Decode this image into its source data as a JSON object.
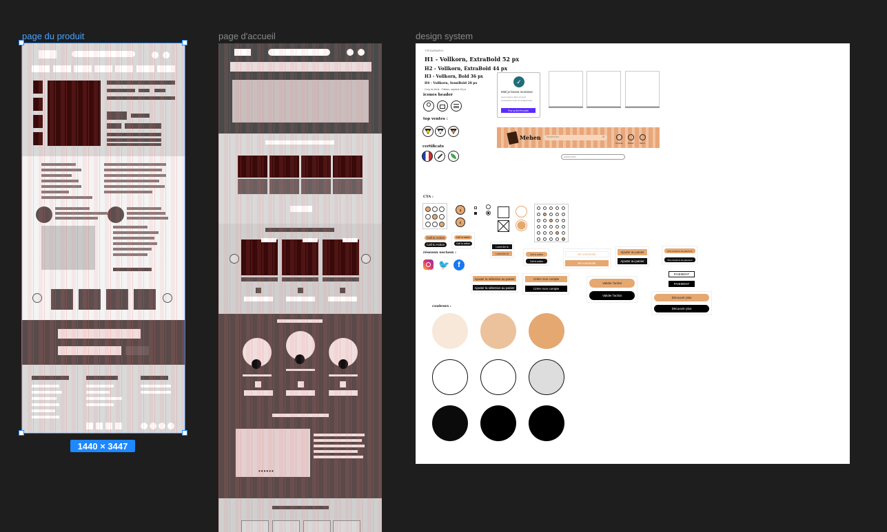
{
  "frames": {
    "product": {
      "label": "page du produit",
      "size_badge": "1440 × 3447"
    },
    "home": {
      "label": "page d'accueil"
    },
    "design": {
      "label": "design system"
    }
  },
  "design_system": {
    "typography_title": "TYPOGRAPHY",
    "h1": "H1 - Vollkorn, ExtraBold 52 px",
    "h2": "H2 - Vollkorn, ExtraBold 44 px",
    "h3": "H3 - Vollkorn, Bold 36 px",
    "h4": "H4 - Vollkorn, SemiBold 28 px",
    "body": "Corp du texte : Fallaso, sapidus 18 px",
    "icons_header": "icones header",
    "top_ventes": "top ventes :",
    "certificats": "certificats",
    "cta": "CTA :",
    "reseaux": "réseaux sociaux :",
    "couleurs": "couleurs :",
    "card_title": "Miel je bosse monsieur",
    "card_text": "Lorem ipsum dolor sit amet consectetur tortor sit volutpat quis",
    "card_btn": "Pour ça lien lien plein",
    "brand": "Mehen",
    "search_placeholder": "Rechercher",
    "search_placeholder2": "placeholder",
    "header_links": [
      "Compte",
      "Panier",
      "Menu"
    ],
    "ctas": {
      "call1": "Call to Action",
      "call2": "Call to Action",
      "call3": "Call to action",
      "call4": "Call to action",
      "lire1": "Lorem lire la",
      "lire2": "Lorem lire la",
      "link1": "Call to action",
      "link2": "Call to action",
      "connect1": "Se connecter",
      "connect2": "Se connecter",
      "ajout1": "Ajouter au panier",
      "ajout2": "Ajouter au panier",
      "ajoutsel1": "Ajouter la sélection au panier",
      "ajoutsel2": "Ajouter la sélection au panier",
      "creer1": "Créer mon compte",
      "creer2": "Créer mon compte",
      "valider1": "Valider l'achat",
      "valider2": "Valider l'achat",
      "petit1": "Plus d'options de paiement",
      "petit2": "Plus d'options de paiement",
      "paiement1": "PAIEMENT",
      "paiement2": "PAIEMENT",
      "decouvrir1": "Découvrir plus",
      "decouvrir2": "Découvrir plus"
    },
    "palette": {
      "row1": [
        "#f7e8da",
        "#ecc29c",
        "#e5a871"
      ],
      "row2": [
        "#ffffff",
        "#ffffff",
        "#dddddd"
      ],
      "row3": [
        "#0b0b0b",
        "#000000",
        "#000000"
      ]
    }
  },
  "colors": {
    "canvas": "#1e1e1e",
    "selection": "#1e88ff",
    "accent": "#e5a871",
    "purple": "#5b2bff"
  }
}
